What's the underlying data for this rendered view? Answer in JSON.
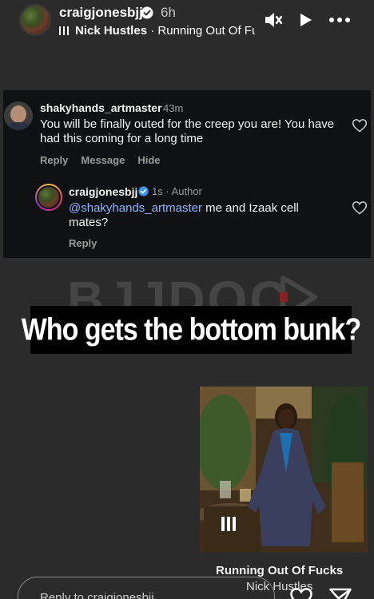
{
  "header": {
    "username": "craigjonesbjj",
    "time_ago": "6h",
    "music_artist": "Nick Hustles",
    "music_separator": " · ",
    "music_title": "Running Out Of Fu"
  },
  "comment": {
    "username": "shakyhands_artmaster",
    "time_ago": "43m",
    "text": "You will be finally outed for the creep you are! You have had this coming for a long time",
    "actions": [
      "Reply",
      "Message",
      "Hide"
    ],
    "reply": {
      "username": "craigjonesbjj",
      "time_ago": "1s · Author",
      "mention": "@shakyhands_artmaster",
      "text": " me and Izaak cell mates?",
      "reply_label": "Reply"
    }
  },
  "watermark": "BJJDOC",
  "banner_text": "Who gets the bottom bunk?",
  "music_card": {
    "title": "Running Out Of Fucks",
    "artist": "Nick Hustles"
  },
  "reply_placeholder": "Reply to craigjonesbjj...",
  "colors": {
    "background": "#2b2b2b",
    "card": "#101114",
    "verified": "#3897f0",
    "mention": "#8fb4ff"
  }
}
